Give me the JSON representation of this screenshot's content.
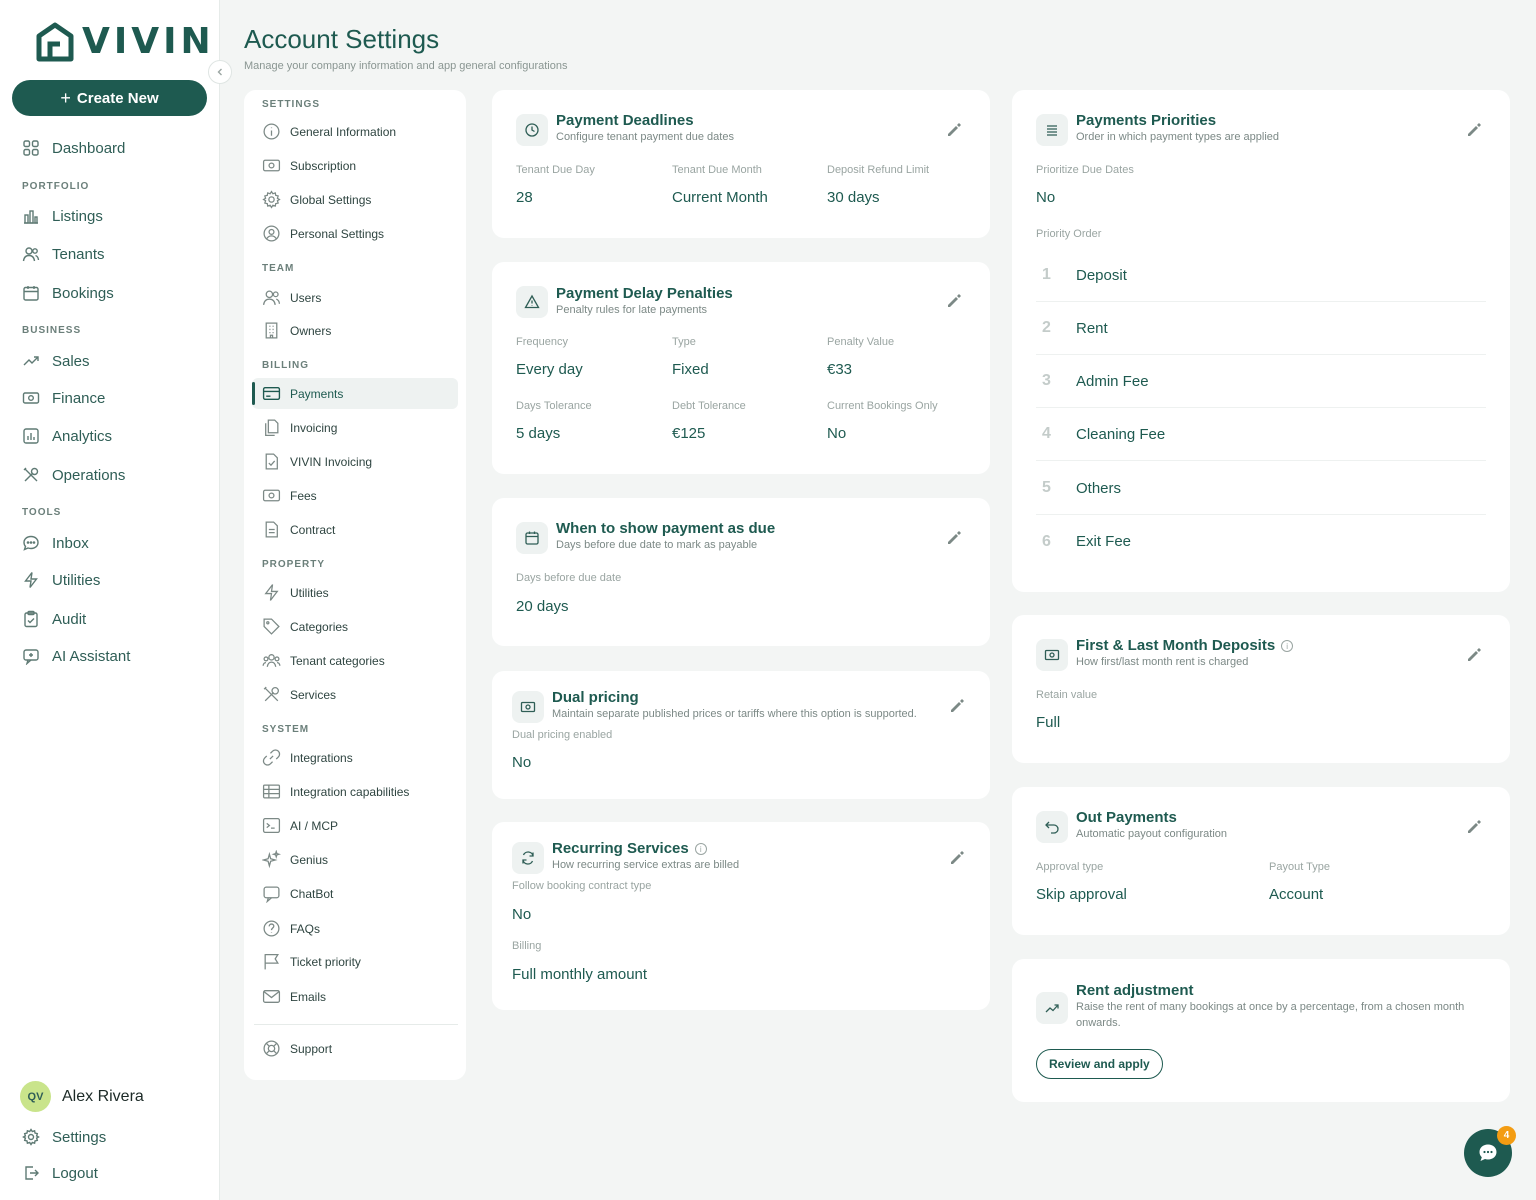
{
  "brand": {
    "name": "VIVIN"
  },
  "sidebar": {
    "create_label": "Create New",
    "items": {
      "dashboard": "Dashboard",
      "listings": "Listings",
      "tenants": "Tenants",
      "bookings": "Bookings",
      "sales": "Sales",
      "finance": "Finance",
      "analytics": "Analytics",
      "operations": "Operations",
      "inbox": "Inbox",
      "utilities": "Utilities",
      "audit": "Audit",
      "ai_assistant": "AI Assistant"
    },
    "sections": {
      "portfolio": "PORTFOLIO",
      "business": "BUSINESS",
      "tools": "TOOLS"
    },
    "user": {
      "initials": "QV",
      "name": "Alex Rivera"
    },
    "settings_label": "Settings",
    "logout_label": "Logout"
  },
  "header": {
    "title": "Account Settings",
    "subtitle": "Manage your company information and app general configurations"
  },
  "settings_menu": {
    "sections": {
      "settings": "SETTINGS",
      "team": "TEAM",
      "billing": "BILLING",
      "property": "PROPERTY",
      "system": "SYSTEM"
    },
    "items": {
      "general_information": "General Information",
      "subscription": "Subscription",
      "global_settings": "Global Settings",
      "personal_settings": "Personal Settings",
      "users": "Users",
      "owners": "Owners",
      "payments": "Payments",
      "invoicing": "Invoicing",
      "vivin_invoicing": "VIVIN Invoicing",
      "fees": "Fees",
      "contract": "Contract",
      "utilities": "Utilities",
      "categories": "Categories",
      "tenant_categories": "Tenant categories",
      "services": "Services",
      "integrations": "Integrations",
      "integration_capabilities": "Integration capabilities",
      "ai_mcp": "AI / MCP",
      "genius": "Genius",
      "chatbot": "ChatBot",
      "faqs": "FAQs",
      "ticket_priority": "Ticket priority",
      "emails": "Emails",
      "support": "Support"
    },
    "active": "Payments"
  },
  "cards": {
    "payment_deadlines": {
      "title": "Payment Deadlines",
      "subtitle": "Configure tenant payment due dates",
      "fields": [
        {
          "label": "Tenant Due Day",
          "value": "28"
        },
        {
          "label": "Tenant Due Month",
          "value": "Current Month"
        },
        {
          "label": "Deposit Refund Limit",
          "value": "30 days"
        }
      ]
    },
    "delay_penalties": {
      "title": "Payment Delay Penalties",
      "subtitle": "Penalty rules for late payments",
      "fields": [
        {
          "label": "Frequency",
          "value": "Every day"
        },
        {
          "label": "Type",
          "value": "Fixed"
        },
        {
          "label": "Penalty Value",
          "value": "€33"
        },
        {
          "label": "Days Tolerance",
          "value": "5 days"
        },
        {
          "label": "Debt Tolerance",
          "value": "€125"
        },
        {
          "label": "Current Bookings Only",
          "value": "No"
        }
      ]
    },
    "show_due": {
      "title": "When to show payment as due",
      "subtitle": "Days before due date to mark as payable",
      "fields": [
        {
          "label": "Days before due date",
          "value": "20 days"
        }
      ]
    },
    "dual_pricing": {
      "title": "Dual pricing",
      "subtitle": "Maintain separate published prices or tariffs where this option is supported.",
      "fields": [
        {
          "label": "Dual pricing enabled",
          "value": "No"
        }
      ]
    },
    "recurring_services": {
      "title": "Recurring Services",
      "subtitle": "How recurring service extras are billed",
      "fields": [
        {
          "label": "Follow booking contract type",
          "value": "No"
        },
        {
          "label": "Billing",
          "value": "Full monthly amount"
        }
      ]
    },
    "payments_priorities": {
      "title": "Payments Priorities",
      "subtitle": "Order in which payment types are applied",
      "prioritize_label": "Prioritize Due Dates",
      "prioritize_value": "No",
      "order_label": "Priority Order",
      "order": [
        {
          "num": "1",
          "name": "Deposit"
        },
        {
          "num": "2",
          "name": "Rent"
        },
        {
          "num": "3",
          "name": "Admin Fee"
        },
        {
          "num": "4",
          "name": "Cleaning Fee"
        },
        {
          "num": "5",
          "name": "Others"
        },
        {
          "num": "6",
          "name": "Exit Fee"
        }
      ]
    },
    "first_last_deposits": {
      "title": "First & Last Month Deposits",
      "subtitle": "How first/last month rent is charged",
      "fields": [
        {
          "label": "Retain value",
          "value": "Full"
        }
      ]
    },
    "out_payments": {
      "title": "Out Payments",
      "subtitle": "Automatic payout configuration",
      "fields": [
        {
          "label": "Approval type",
          "value": "Skip approval"
        },
        {
          "label": "Payout Type",
          "value": "Account"
        }
      ]
    },
    "rent_adjustment": {
      "title": "Rent adjustment",
      "subtitle_line1": "Raise the rent of many bookings at once by a percentage, from a chosen month",
      "subtitle_line2": "onwards.",
      "button_label": "Review and apply"
    }
  },
  "chat": {
    "badge_count": "4"
  },
  "colors": {
    "brand": "#1e5a50",
    "badge": "#f39c12",
    "avatar": "#c9e48b"
  }
}
